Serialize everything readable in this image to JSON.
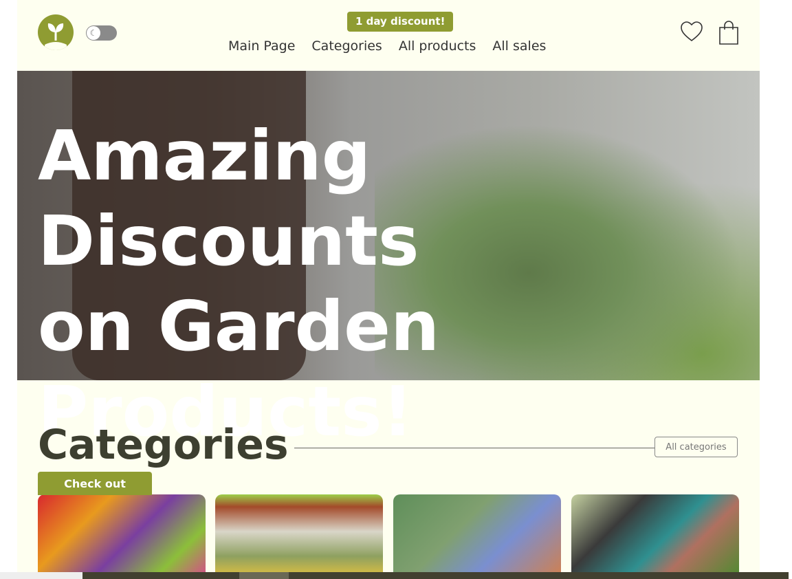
{
  "header": {
    "discount_badge": "1 day discount!",
    "nav": [
      "Main Page",
      "Categories",
      "All products",
      "All sales"
    ]
  },
  "hero": {
    "title": "Amazing Discounts on Garden Products!",
    "cta": "Check out"
  },
  "categories": {
    "title": "Categories",
    "all_label": "All categories"
  },
  "colors": {
    "accent": "#8f9c32",
    "background": "#fefff0",
    "heading": "#3d3f30"
  }
}
